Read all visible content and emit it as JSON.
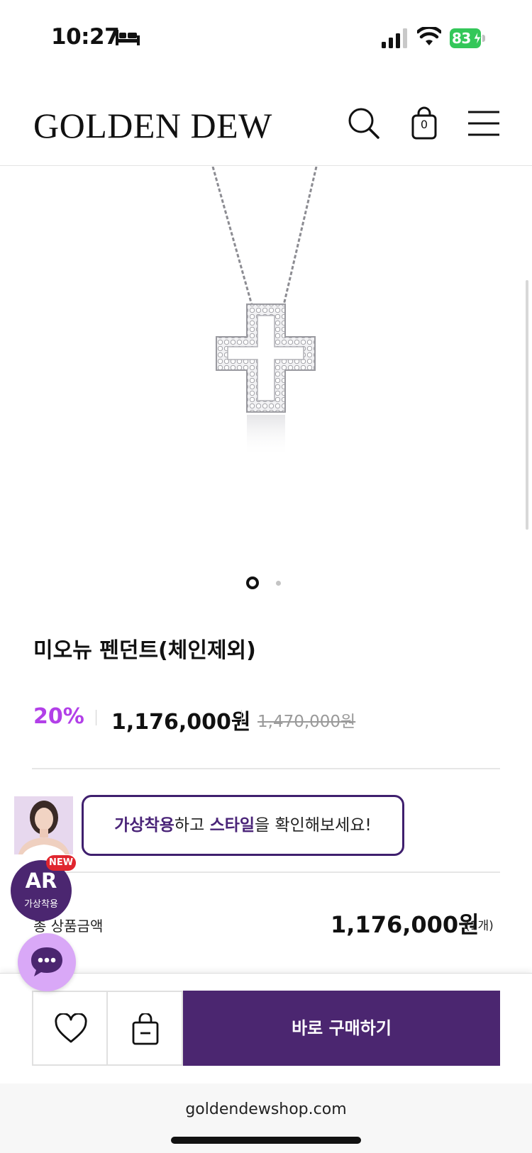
{
  "status_bar": {
    "time": "10:27",
    "battery": "83",
    "icons": [
      "sleep-icon",
      "signal-icon",
      "wifi-icon",
      "battery-icon"
    ]
  },
  "header": {
    "logo": "GOLDEN DEW",
    "cart_count": "0",
    "icons": [
      "search-icon",
      "cart-icon",
      "menu-icon"
    ]
  },
  "gallery": {
    "image": "cross-pendant-necklace",
    "current_slide": 1,
    "total_slides": 2
  },
  "product": {
    "title": "미오뉴 펜던트(체인제외)",
    "discount": "20%",
    "price": "1,176,000원",
    "original_price": "1,470,000원"
  },
  "ar_banner": {
    "text_bold_1": "가상착용",
    "text_1": "하고 ",
    "text_bold_2": "스타일",
    "text_2": "을 확인해보세요!"
  },
  "ar_badge": {
    "title": "AR",
    "subtitle": "가상착용",
    "new_label": "NEW"
  },
  "total": {
    "label": "총 상품금액",
    "price": "1,176,000원",
    "quantity": "(1개)"
  },
  "actions": {
    "buy_now": "바로 구매하기"
  },
  "browser": {
    "url": "goldendewshop.com"
  },
  "colors": {
    "brand_purple": "#4b2670",
    "discount_purple": "#b23fe8",
    "new_red": "#e0262f",
    "chat_bubble": "#d9a8f7",
    "battery_green": "#34c759"
  }
}
